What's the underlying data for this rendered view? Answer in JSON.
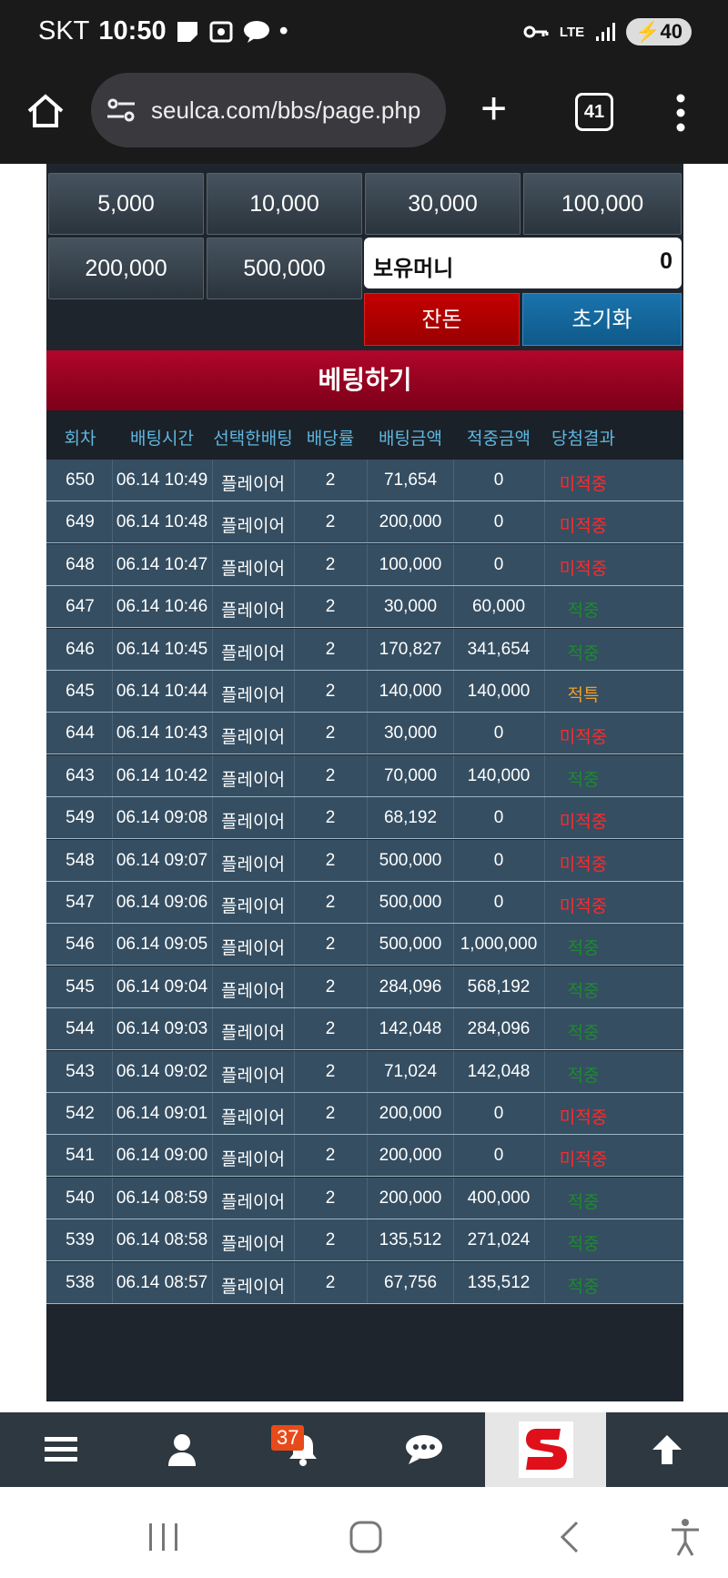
{
  "status_bar": {
    "carrier": "SKT",
    "time": "10:50",
    "network": "LTE",
    "battery": "40"
  },
  "browser": {
    "url": "seulca.com/bbs/page.php",
    "tab_count": "41"
  },
  "amount_buttons": [
    "5,000",
    "10,000",
    "30,000",
    "100,000",
    "200,000",
    "500,000"
  ],
  "money": {
    "label": "보유머니",
    "value": "0"
  },
  "buttons": {
    "all_in": "잔돈",
    "reset": "초기화"
  },
  "bet_header": "베팅하기",
  "columns": [
    "회차",
    "배팅시간",
    "선택한배팅",
    "배당률",
    "배팅금액",
    "적중금액",
    "당첨결과"
  ],
  "rows": [
    [
      "650",
      "06.14 10:49",
      "플레이어",
      "2",
      "71,654",
      "0",
      "미적중"
    ],
    [
      "649",
      "06.14 10:48",
      "플레이어",
      "2",
      "200,000",
      "0",
      "미적중"
    ],
    [
      "648",
      "06.14 10:47",
      "플레이어",
      "2",
      "100,000",
      "0",
      "미적중"
    ],
    [
      "647",
      "06.14 10:46",
      "플레이어",
      "2",
      "30,000",
      "60,000",
      "적중"
    ],
    [
      "646",
      "06.14 10:45",
      "플레이어",
      "2",
      "170,827",
      "341,654",
      "적중"
    ],
    [
      "645",
      "06.14 10:44",
      "플레이어",
      "2",
      "140,000",
      "140,000",
      "적특"
    ],
    [
      "644",
      "06.14 10:43",
      "플레이어",
      "2",
      "30,000",
      "0",
      "미적중"
    ],
    [
      "643",
      "06.14 10:42",
      "플레이어",
      "2",
      "70,000",
      "140,000",
      "적중"
    ],
    [
      "549",
      "06.14 09:08",
      "플레이어",
      "2",
      "68,192",
      "0",
      "미적중"
    ],
    [
      "548",
      "06.14 09:07",
      "플레이어",
      "2",
      "500,000",
      "0",
      "미적중"
    ],
    [
      "547",
      "06.14 09:06",
      "플레이어",
      "2",
      "500,000",
      "0",
      "미적중"
    ],
    [
      "546",
      "06.14 09:05",
      "플레이어",
      "2",
      "500,000",
      "1,000,000",
      "적중"
    ],
    [
      "545",
      "06.14 09:04",
      "플레이어",
      "2",
      "284,096",
      "568,192",
      "적중"
    ],
    [
      "544",
      "06.14 09:03",
      "플레이어",
      "2",
      "142,048",
      "284,096",
      "적중"
    ],
    [
      "543",
      "06.14 09:02",
      "플레이어",
      "2",
      "71,024",
      "142,048",
      "적중"
    ],
    [
      "542",
      "06.14 09:01",
      "플레이어",
      "2",
      "200,000",
      "0",
      "미적중"
    ],
    [
      "541",
      "06.14 09:00",
      "플레이어",
      "2",
      "200,000",
      "0",
      "미적중"
    ],
    [
      "540",
      "06.14 08:59",
      "플레이어",
      "2",
      "200,000",
      "400,000",
      "적중"
    ],
    [
      "539",
      "06.14 08:58",
      "플레이어",
      "2",
      "135,512",
      "271,024",
      "적중"
    ],
    [
      "538",
      "06.14 08:57",
      "플레이어",
      "2",
      "67,756",
      "135,512",
      "적중"
    ]
  ],
  "result_colors": {
    "미적중": "#ff2a2a",
    "적중": "#1e8a2e",
    "적특": "#f0a020"
  },
  "bottom_nav": {
    "notification_count": "37",
    "icons": [
      "menu-icon",
      "user-icon",
      "bell-icon",
      "chat-icon",
      "site-logo",
      "arrow-up-icon"
    ]
  }
}
